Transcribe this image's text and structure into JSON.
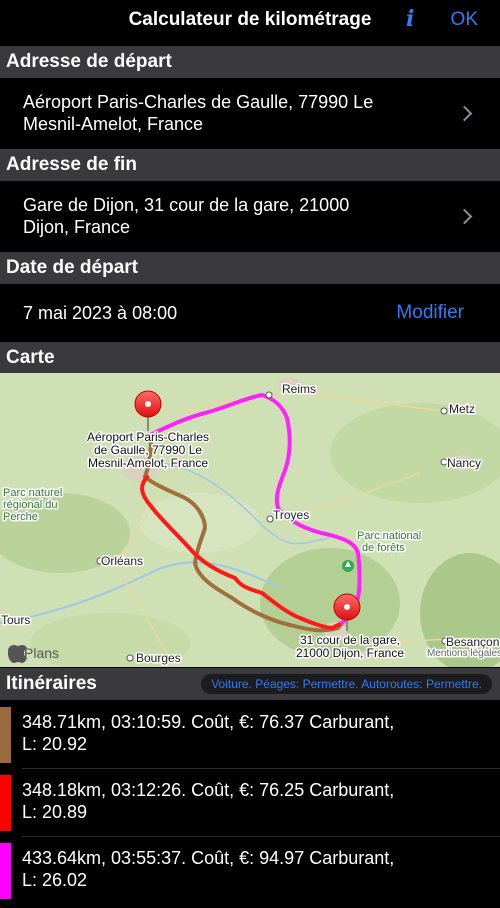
{
  "nav": {
    "title": "Calculateur de kilométrage",
    "info_label": "i",
    "ok_label": "OK"
  },
  "colors": {
    "accent": "#2f7cf6",
    "header_bg": "#3a3a3c"
  },
  "start_address": {
    "header": "Adresse de départ",
    "line1": "Aéroport Paris-Charles de Gaulle, 77990 Le",
    "line2": "Mesnil-Amelot, France"
  },
  "end_address": {
    "header": "Adresse de fin",
    "line1": "Gare de Dijon, 31 cour de la gare, 21000",
    "line2": "Dijon, France"
  },
  "departure": {
    "header": "Date de départ",
    "value": "7 mai 2023 à 08:00",
    "modify_label": "Modifier"
  },
  "map": {
    "header": "Carte",
    "cities": {
      "reims": "Reims",
      "metz": "Metz",
      "nancy": "Nancy",
      "troyes": "Troyes",
      "orleans": "Orléans",
      "tours": "Tours",
      "bourges": "Bourges",
      "besancon": "Besançon"
    },
    "parks": {
      "perche_1": "Parc naturel",
      "perche_2": "régional du",
      "perche_3": "Perche",
      "forets_1": "Parc national",
      "forets_2": "de forêts"
    },
    "start_label": [
      "Aéroport Paris-Charles",
      "de Gaulle, 77990 Le",
      "Mesnil-Amelot, France"
    ],
    "end_label": [
      "31 cour de la gare,",
      "21000 Dijon, France"
    ],
    "attribution": "Plans",
    "legal": "Mentions légales",
    "route_colors": {
      "brown": "#a0703c",
      "red": "#ff1a1a",
      "magenta": "#ff22ff"
    }
  },
  "itineraries": {
    "header": "Itinéraires",
    "options": "Voiture. Péages: Permettre. Autoroutes: Permettre.",
    "routes": [
      {
        "color": "#9b6a3c",
        "line1": "348.71km, 03:10:59. Coût, €: 76.37 Carburant,",
        "line2": "L: 20.92"
      },
      {
        "color": "#ff0000",
        "line1": "348.18km, 03:12:26. Coût, €: 76.25 Carburant,",
        "line2": "L: 20.89"
      },
      {
        "color": "#ff00ff",
        "line1": "433.64km, 03:55:37. Coût, €: 94.97 Carburant,",
        "line2": "L: 26.02"
      }
    ]
  }
}
